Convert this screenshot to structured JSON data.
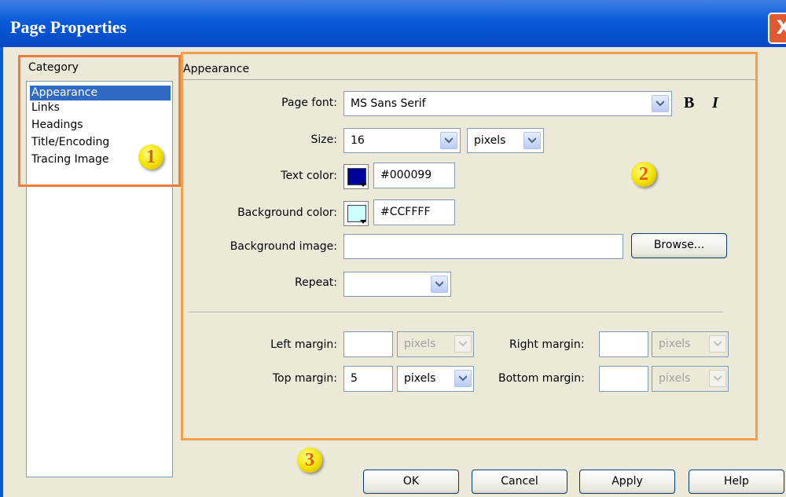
{
  "window": {
    "title": "Page Properties",
    "close_glyph": "X"
  },
  "category": {
    "label": "Category",
    "items": [
      "Appearance",
      "Links",
      "Headings",
      "Title/Encoding",
      "Tracing Image"
    ],
    "selected": "Appearance"
  },
  "panel": {
    "heading": "Appearance"
  },
  "form": {
    "page_font": {
      "label": "Page font:",
      "value": "MS Sans Serif"
    },
    "bold_label": "B",
    "italic_label": "I",
    "size": {
      "label": "Size:",
      "value": "16",
      "unit": "pixels"
    },
    "text_color": {
      "label": "Text color:",
      "value": "#000099",
      "swatch": "#000099"
    },
    "background_color": {
      "label": "Background color:",
      "value": "#CCFFFF",
      "swatch": "#CCFFFF"
    },
    "background_image": {
      "label": "Background image:",
      "value": "",
      "browse_label": "Browse..."
    },
    "repeat": {
      "label": "Repeat:",
      "value": ""
    },
    "left_margin": {
      "label": "Left margin:",
      "value": "",
      "unit": "pixels"
    },
    "right_margin": {
      "label": "Right margin:",
      "value": "",
      "unit": "pixels"
    },
    "top_margin": {
      "label": "Top margin:",
      "value": "5",
      "unit": "pixels"
    },
    "bottom_margin": {
      "label": "Bottom margin:",
      "value": "",
      "unit": "pixels"
    }
  },
  "buttons": {
    "ok": "OK",
    "cancel": "Cancel",
    "apply": "Apply",
    "help": "Help"
  },
  "callouts": {
    "one": "1",
    "two": "2",
    "three": "3"
  },
  "colors": {
    "title_bar": "#0a5bd8",
    "highlight_box_1": "#f07b3b",
    "highlight_box_2": "#f5a048",
    "selection": "#316ac5"
  }
}
